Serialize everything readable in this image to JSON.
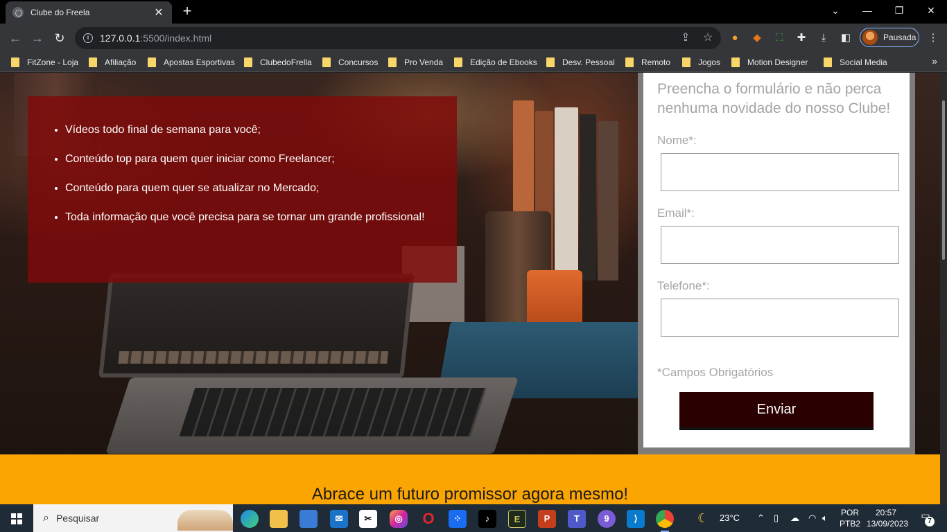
{
  "browser": {
    "tab_title": "Clube do Freela",
    "close_glyph": "✕",
    "new_tab_glyph": "+",
    "url_host": "127.0.0.1",
    "url_path": ":5500/index.html",
    "profile_label": "Pausada",
    "window_controls": {
      "minimize": "—",
      "restore": "❐",
      "close": "✕",
      "tab_search": "⌄"
    }
  },
  "bookmarks": [
    "FitZone - Loja",
    "Afiliação",
    "Apostas Esportivas",
    "ClubedoFrella",
    "Concursos",
    "Pro Venda",
    "Edição de Ebooks",
    "Desv. Pessoal",
    "Remoto",
    "Jogos",
    "Motion Designer",
    "Social Media"
  ],
  "bookmarks_more": "»",
  "page": {
    "benefits": [
      "Vídeos todo final de semana para você;",
      "Conteúdo top para quem quer iniciar como Freelancer;",
      "Conteúdo para quem quer se atualizar no Mercado;",
      "Toda informação que você precisa para se tornar um grande profissional!"
    ],
    "form": {
      "heading": "Preencha o formulário e não perca nenhuma novidade do nosso Clube!",
      "name_label": "Nome*:",
      "email_label": "Email*:",
      "phone_label": "Telefone*:",
      "required_note": "*Campos Obrigatórios",
      "submit_label": "Enviar"
    },
    "cta_heading": "Abrace um futuro promissor agora mesmo!"
  },
  "taskbar": {
    "search_placeholder": "Pesquisar",
    "weather": "23°C",
    "language_line1": "POR",
    "language_line2": "PTB2",
    "time": "20:57",
    "date": "13/09/2023",
    "notification_count": "7"
  },
  "colors": {
    "info_box": "#800a0a",
    "submit_button": "#2b0000",
    "cta_band": "#fba502"
  }
}
